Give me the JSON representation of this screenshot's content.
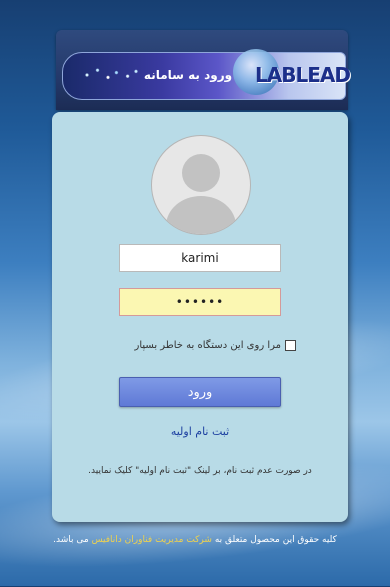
{
  "banner": {
    "title": "ورود به سامانه",
    "logo_text": "LABLEAD"
  },
  "form": {
    "username_value": "karimi",
    "password_value": "••••••",
    "remember_label": "مرا روی این دستگاه به خاطر بسپار",
    "remember_checked": false,
    "submit_label": "ورود",
    "register_link": "ثبت نام اولیه",
    "note": "در صورت عدم ثبت نام، بر لینک \"ثبت نام اولیه\" کلیک نمایید."
  },
  "footer": {
    "prefix": "کلیه حقوق این محصول متعلق به ",
    "company": "شرکت مدیریت فناوران دانافیس",
    "suffix": " می باشد.",
    "company_color": "#f0d24c"
  },
  "colors": {
    "panel": "#b8dbe7",
    "button": "#6f8ae0",
    "password_bg": "#fbf7b2",
    "link": "#1b3ea0"
  }
}
